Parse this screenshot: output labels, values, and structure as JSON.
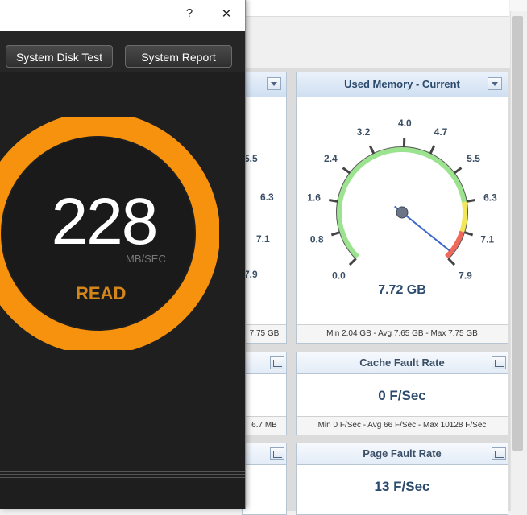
{
  "window": {
    "help_symbol": "?",
    "close_symbol": "✕"
  },
  "toolbar": {
    "disk_test_label": "System Disk Test",
    "report_label": "System Report"
  },
  "gauge": {
    "value": "228",
    "unit": "MB/SEC",
    "label": "READ",
    "ring_color": "#f7920f"
  },
  "panels": {
    "left_gauge": {
      "visible_ticks": [
        "5.5",
        "6.3",
        "7.1",
        "7.9"
      ],
      "footer_partial": "7.75 GB"
    },
    "used_memory": {
      "title": "Used Memory - Current",
      "ticks": [
        "0.0",
        "0.8",
        "1.6",
        "2.4",
        "3.2",
        "4.0",
        "4.7",
        "5.5",
        "6.3",
        "7.1",
        "7.9"
      ],
      "value": 7.72,
      "value_label": "7.72 GB",
      "footer": "Min 2.04 GB - Avg 7.65 GB - Max 7.75 GB"
    },
    "left_middle": {
      "footer_partial": "6.7 MB"
    },
    "cache_fault": {
      "title": "Cache Fault Rate",
      "value": "0 F/Sec",
      "footer": "Min 0 F/Sec - Avg 66 F/Sec - Max 10128 F/Sec"
    },
    "page_fault": {
      "title": "Page Fault Rate",
      "value": "13 F/Sec"
    }
  }
}
